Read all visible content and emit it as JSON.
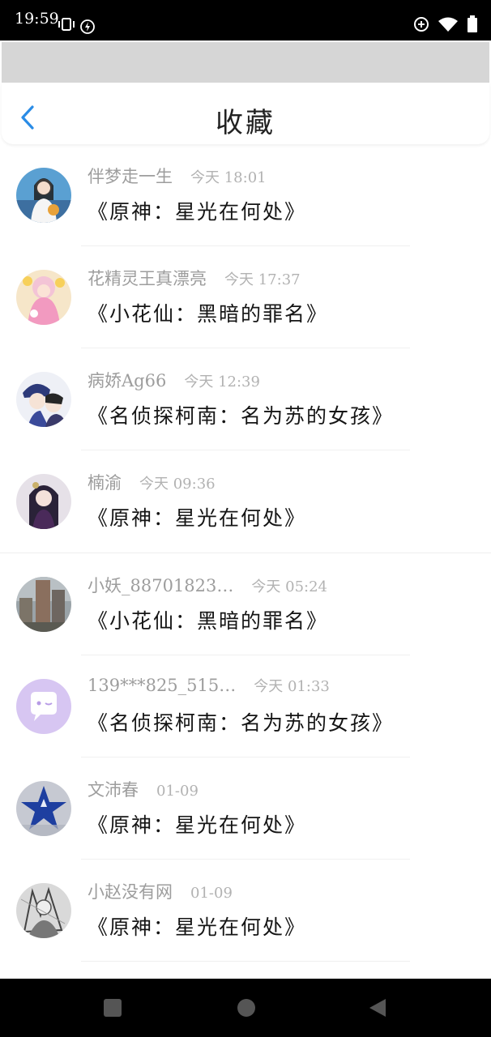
{
  "status_bar": {
    "time": "19:59"
  },
  "header": {
    "title": "收藏"
  },
  "favorites": [
    {
      "user": "伴梦走一生",
      "time": "今天 18:01",
      "title": "《原神：星光在何处》",
      "avatar": "avatar-girl-photo-icon"
    },
    {
      "user": "花精灵王真漂亮",
      "time": "今天 17:37",
      "title": "《小花仙：黑暗的罪名》",
      "avatar": "avatar-flower-fairy-icon"
    },
    {
      "user": "病娇Ag66",
      "time": "今天 12:39",
      "title": "《名侦探柯南：名为苏的女孩》",
      "avatar": "avatar-detective-anime-icon"
    },
    {
      "user": "楠渝",
      "time": "今天 09:36",
      "title": "《原神：星光在何处》",
      "avatar": "avatar-anime-girl-icon"
    },
    {
      "user": "小妖_88701823…",
      "time": "今天 05:24",
      "title": "《小花仙：黑暗的罪名》",
      "avatar": "avatar-city-building-icon"
    },
    {
      "user": "139***825_515…",
      "time": "今天 01:33",
      "title": "《名侦探柯南：名为苏的女孩》",
      "avatar": "avatar-chat-bubble-icon"
    },
    {
      "user": "文沛春",
      "time": "01-09",
      "title": "《原神：星光在何处》",
      "avatar": "avatar-blue-star-icon"
    },
    {
      "user": "小赵没有网",
      "time": "01-09",
      "title": "《原神：星光在何处》",
      "avatar": "avatar-sketch-art-icon"
    }
  ]
}
